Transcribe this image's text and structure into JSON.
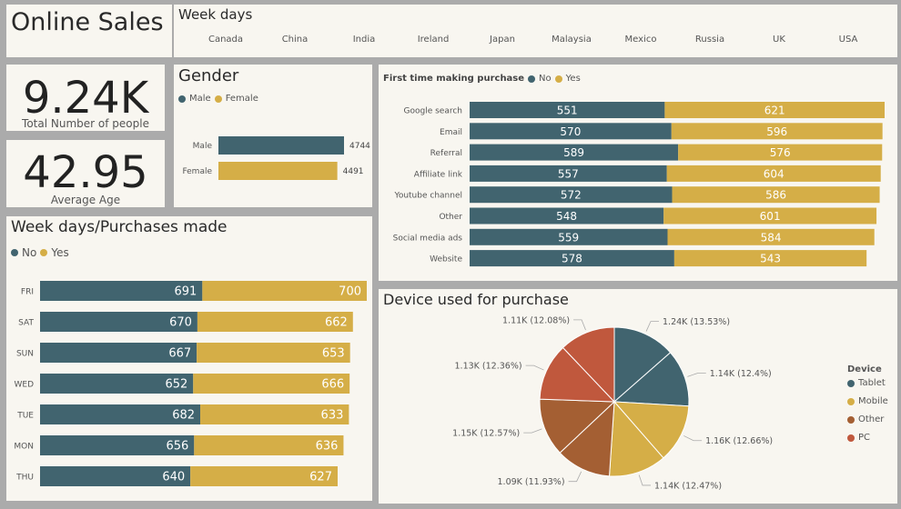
{
  "header": {
    "title": "Online Sales"
  },
  "weekdays_slicer": {
    "title": "Week days",
    "countries": [
      "Canada",
      "China",
      "India",
      "Ireland",
      "Japan",
      "Malaysia",
      "Mexico",
      "Russia",
      "UK",
      "USA"
    ]
  },
  "kpis": [
    {
      "value": "9.24K",
      "label": "Total Number of people"
    },
    {
      "value": "42.95",
      "label": "Average Age"
    }
  ],
  "colors": {
    "no": "#41646f",
    "yes": "#d5ae47",
    "other": "#a45f33",
    "pc": "#c0583d",
    "bg": "#f8f6f0"
  },
  "legends": {
    "gender": [
      "Male",
      "Female"
    ],
    "weekday": [
      "No",
      "Yes"
    ],
    "first": {
      "title": "First time making purchase",
      "items": [
        "No",
        "Yes"
      ]
    },
    "device": {
      "title": "Device",
      "items": [
        "Tablet",
        "Mobile",
        "Other",
        "PC"
      ]
    }
  },
  "chart_data": [
    {
      "id": "gender",
      "type": "bar",
      "title": "Gender",
      "orientation": "horizontal",
      "categories": [
        "Male",
        "Female"
      ],
      "values": [
        4744,
        4491
      ]
    },
    {
      "id": "weekday",
      "type": "bar",
      "title": "Week days/Purchases made",
      "orientation": "horizontal",
      "stacked": true,
      "categories": [
        "FRI",
        "SAT",
        "SUN",
        "WED",
        "TUE",
        "MON",
        "THU"
      ],
      "series": [
        {
          "name": "No",
          "values": [
            691,
            670,
            667,
            652,
            682,
            656,
            640
          ]
        },
        {
          "name": "Yes",
          "values": [
            700,
            662,
            653,
            666,
            633,
            636,
            627
          ]
        }
      ]
    },
    {
      "id": "first",
      "type": "bar",
      "title": "First time making purchase",
      "orientation": "horizontal",
      "stacked": true,
      "categories": [
        "Google search",
        "Email",
        "Referral",
        "Affiliate link",
        "Youtube channel",
        "Other",
        "Social media ads",
        "Website"
      ],
      "series": [
        {
          "name": "No",
          "values": [
            551,
            570,
            589,
            557,
            572,
            548,
            559,
            578
          ]
        },
        {
          "name": "Yes",
          "values": [
            621,
            596,
            576,
            604,
            586,
            601,
            584,
            543
          ]
        }
      ]
    },
    {
      "id": "device",
      "type": "pie",
      "title": "Device used for purchase",
      "legend_title": "Device",
      "slices": [
        {
          "label": "1.24K (13.53%)",
          "value": 13.53,
          "group": "Tablet"
        },
        {
          "label": "1.14K (12.4%)",
          "value": 12.4,
          "group": "Tablet"
        },
        {
          "label": "1.16K (12.66%)",
          "value": 12.66,
          "group": "Mobile"
        },
        {
          "label": "1.14K (12.47%)",
          "value": 12.47,
          "group": "Mobile"
        },
        {
          "label": "1.09K (11.93%)",
          "value": 11.93,
          "group": "Other"
        },
        {
          "label": "1.15K (12.57%)",
          "value": 12.57,
          "group": "Other"
        },
        {
          "label": "1.13K (12.36%)",
          "value": 12.36,
          "group": "PC"
        },
        {
          "label": "1.11K (12.08%)",
          "value": 12.08,
          "group": "PC"
        }
      ]
    }
  ]
}
